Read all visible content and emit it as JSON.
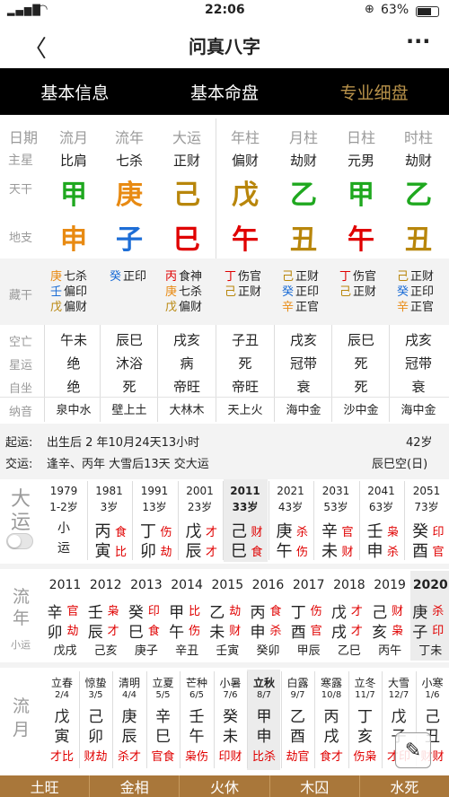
{
  "status": {
    "time": "22:06",
    "battery": "63%"
  },
  "nav": {
    "title": "问真八字"
  },
  "tabs": [
    {
      "label": "基本信息"
    },
    {
      "label": "基本命盘"
    },
    {
      "label": "专业细盘"
    }
  ],
  "header_row": [
    "日期",
    "流月",
    "流年",
    "大运",
    "年柱",
    "月柱",
    "日柱",
    "时柱"
  ],
  "zhuxing": {
    "label": "主星",
    "values": [
      "比肩",
      "七杀",
      "正财",
      "偏财",
      "劫财",
      "元男",
      "劫财"
    ]
  },
  "tiangan": {
    "label": "天干",
    "values": [
      "甲",
      "庚",
      "己",
      "戊",
      "乙",
      "甲",
      "乙"
    ]
  },
  "dizhi": {
    "label": "地支",
    "values": [
      "申",
      "子",
      "巳",
      "午",
      "丑",
      "午",
      "丑"
    ]
  },
  "canggan": {
    "label": "藏干",
    "cols": [
      [
        {
          "g": "庚",
          "s": "七杀"
        },
        {
          "g": "壬",
          "s": "偏印"
        },
        {
          "g": "戊",
          "s": "偏财"
        }
      ],
      [
        {
          "g": "癸",
          "s": "正印"
        }
      ],
      [
        {
          "g": "丙",
          "s": "食神"
        },
        {
          "g": "庚",
          "s": "七杀"
        },
        {
          "g": "戊",
          "s": "偏财"
        }
      ],
      [
        {
          "g": "丁",
          "s": "伤官"
        },
        {
          "g": "己",
          "s": "正财"
        }
      ],
      [
        {
          "g": "己",
          "s": "正财"
        },
        {
          "g": "癸",
          "s": "正印"
        },
        {
          "g": "辛",
          "s": "正官"
        }
      ],
      [
        {
          "g": "丁",
          "s": "伤官"
        },
        {
          "g": "己",
          "s": "正财"
        }
      ],
      [
        {
          "g": "己",
          "s": "正财"
        },
        {
          "g": "癸",
          "s": "正印"
        },
        {
          "g": "辛",
          "s": "正官"
        }
      ]
    ]
  },
  "kongwang": {
    "label": "空亡",
    "values": [
      "午未",
      "辰巳",
      "戌亥",
      "子丑",
      "戌亥",
      "辰巳",
      "戌亥"
    ]
  },
  "xingyun": {
    "label": "星运",
    "values": [
      "绝",
      "沐浴",
      "病",
      "死",
      "冠带",
      "死",
      "冠带"
    ]
  },
  "zizuo": {
    "label": "自坐",
    "values": [
      "绝",
      "死",
      "帝旺",
      "帝旺",
      "衰",
      "死",
      "衰"
    ]
  },
  "nayin": {
    "label": "纳音",
    "values": [
      "泉中水",
      "壁上土",
      "大林木",
      "天上火",
      "海中金",
      "沙中金",
      "海中金"
    ]
  },
  "qiyun": {
    "label": "起运:",
    "text": "出生后 2 年10月24天13小时",
    "age": "42岁"
  },
  "jiaoyun": {
    "label": "交运:",
    "text": "逢辛、丙年 大雪后13天 交大运",
    "kong": "辰巳空(日)"
  },
  "dayun": {
    "title1": "大",
    "title2": "运",
    "items": [
      {
        "year": "1979",
        "age": "1-2岁",
        "g": "小",
        "z": "运",
        "ss1": "",
        "ss2": ""
      },
      {
        "year": "1981",
        "age": "3岁",
        "g": "丙",
        "z": "寅",
        "ss1": "食",
        "ss2": "比"
      },
      {
        "year": "1991",
        "age": "13岁",
        "g": "丁",
        "z": "卯",
        "ss1": "伤",
        "ss2": "劫"
      },
      {
        "year": "2001",
        "age": "23岁",
        "g": "戊",
        "z": "辰",
        "ss1": "才",
        "ss2": "才"
      },
      {
        "year": "2011",
        "age": "33岁",
        "g": "己",
        "z": "巳",
        "ss1": "财",
        "ss2": "食"
      },
      {
        "year": "2021",
        "age": "43岁",
        "g": "庚",
        "z": "午",
        "ss1": "杀",
        "ss2": "伤"
      },
      {
        "year": "2031",
        "age": "53岁",
        "g": "辛",
        "z": "未",
        "ss1": "官",
        "ss2": "财"
      },
      {
        "year": "2041",
        "age": "63岁",
        "g": "壬",
        "z": "申",
        "ss1": "枭",
        "ss2": "杀"
      },
      {
        "year": "2051",
        "age": "73岁",
        "g": "癸",
        "z": "酉",
        "ss1": "印",
        "ss2": "官"
      }
    ]
  },
  "liunian": {
    "title1": "流",
    "title2": "年",
    "xiaoyun": "小运",
    "items": [
      {
        "year": "2011",
        "g": "辛",
        "z": "卯",
        "ss1": "官",
        "ss2": "劫",
        "xy": "戊戌"
      },
      {
        "year": "2012",
        "g": "壬",
        "z": "辰",
        "ss1": "枭",
        "ss2": "才",
        "xy": "己亥"
      },
      {
        "year": "2013",
        "g": "癸",
        "z": "巳",
        "ss1": "印",
        "ss2": "食",
        "xy": "庚子"
      },
      {
        "year": "2014",
        "g": "甲",
        "z": "午",
        "ss1": "比",
        "ss2": "伤",
        "xy": "辛丑"
      },
      {
        "year": "2015",
        "g": "乙",
        "z": "未",
        "ss1": "劫",
        "ss2": "财",
        "xy": "壬寅"
      },
      {
        "year": "2016",
        "g": "丙",
        "z": "申",
        "ss1": "食",
        "ss2": "杀",
        "xy": "癸卯"
      },
      {
        "year": "2017",
        "g": "丁",
        "z": "酉",
        "ss1": "伤",
        "ss2": "官",
        "xy": "甲辰"
      },
      {
        "year": "2018",
        "g": "戊",
        "z": "戌",
        "ss1": "才",
        "ss2": "才",
        "xy": "乙巳"
      },
      {
        "year": "2019",
        "g": "己",
        "z": "亥",
        "ss1": "财",
        "ss2": "枭",
        "xy": "丙午"
      },
      {
        "year": "2020",
        "g": "庚",
        "z": "子",
        "ss1": "杀",
        "ss2": "印",
        "xy": "丁未"
      }
    ]
  },
  "liuyue": {
    "title1": "流",
    "title2": "月",
    "items": [
      {
        "jie": "立春",
        "date": "2/4",
        "g": "戊",
        "z": "寅",
        "ss": "才比"
      },
      {
        "jie": "惊蛰",
        "date": "3/5",
        "g": "己",
        "z": "卯",
        "ss": "财劫"
      },
      {
        "jie": "清明",
        "date": "4/4",
        "g": "庚",
        "z": "辰",
        "ss": "杀才"
      },
      {
        "jie": "立夏",
        "date": "5/5",
        "g": "辛",
        "z": "巳",
        "ss": "官食"
      },
      {
        "jie": "芒种",
        "date": "6/5",
        "g": "壬",
        "z": "午",
        "ss": "枭伤"
      },
      {
        "jie": "小暑",
        "date": "7/6",
        "g": "癸",
        "z": "未",
        "ss": "印财"
      },
      {
        "jie": "立秋",
        "date": "8/7",
        "g": "甲",
        "z": "申",
        "ss": "比杀"
      },
      {
        "jie": "白露",
        "date": "9/7",
        "g": "乙",
        "z": "酉",
        "ss": "劫官"
      },
      {
        "jie": "寒露",
        "date": "10/8",
        "g": "丙",
        "z": "戌",
        "ss": "食才"
      },
      {
        "jie": "立冬",
        "date": "11/7",
        "g": "丁",
        "z": "亥",
        "ss": "伤枭"
      },
      {
        "jie": "大雪",
        "date": "12/7",
        "g": "戊",
        "z": "子",
        "ss": "才印"
      },
      {
        "jie": "小寒",
        "date": "1/6",
        "g": "己",
        "z": "丑",
        "ss": "财财"
      }
    ]
  },
  "footer": [
    "土旺",
    "金相",
    "火休",
    "木囚",
    "水死"
  ]
}
